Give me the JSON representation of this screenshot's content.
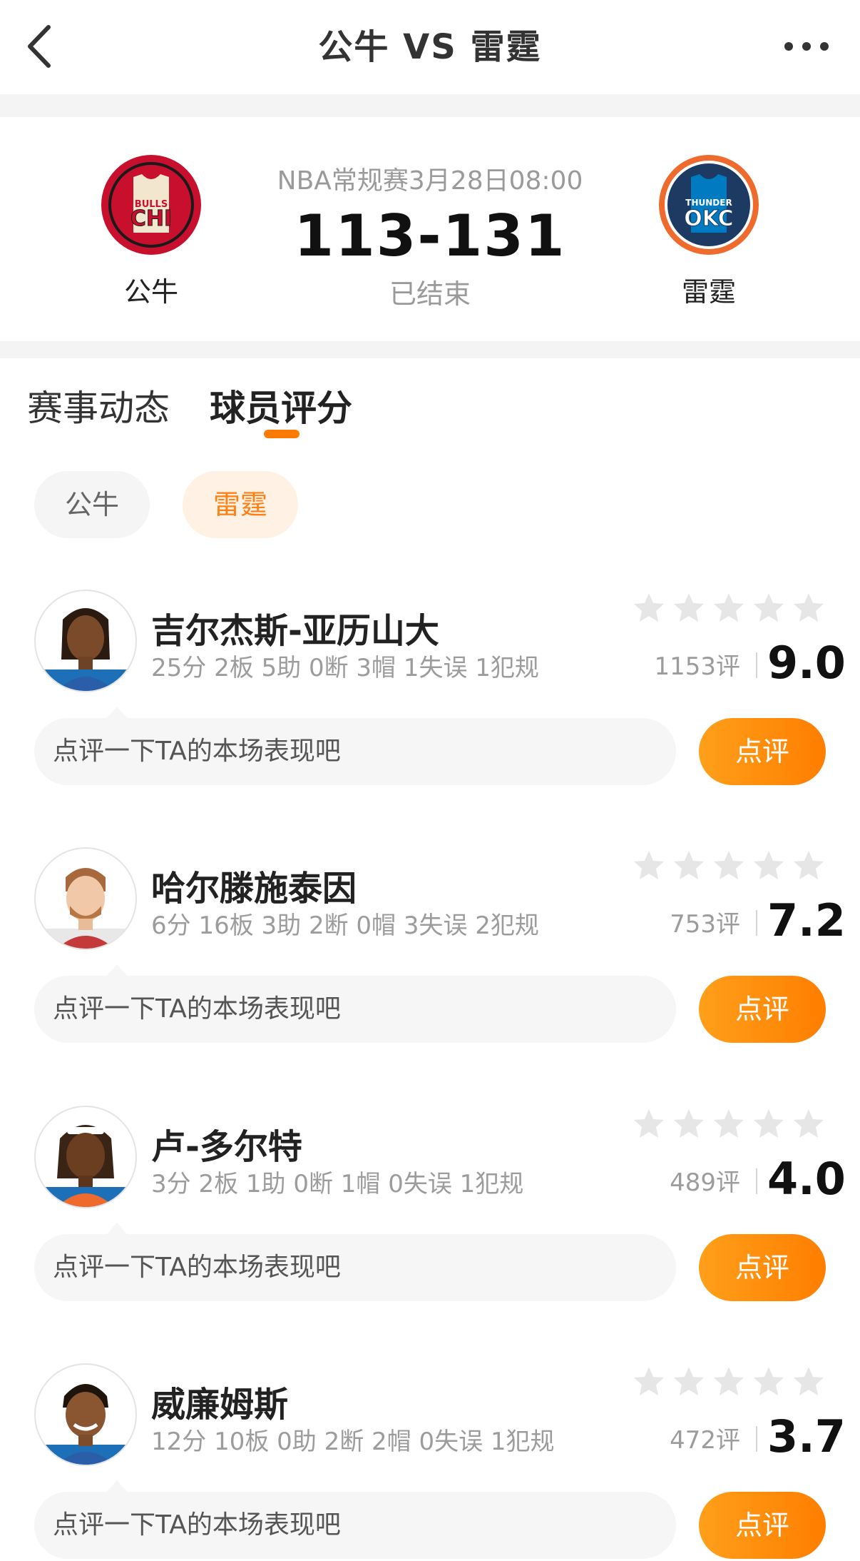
{
  "nav": {
    "title": "公牛 VS 雷霆"
  },
  "match": {
    "info": "NBA常规赛3月28日08:00",
    "score": "113-131",
    "status": "已结束",
    "home": {
      "name": "公牛",
      "logo_text_top": "BULLS",
      "logo_text": "CHI",
      "color": "#c8102e"
    },
    "away": {
      "name": "雷霆",
      "logo_text_top": "THUNDER",
      "logo_text": "OKC",
      "color": "#007ac1",
      "ring": "#ef6a2d"
    }
  },
  "tabs": [
    {
      "label": "赛事动态"
    },
    {
      "label": "球员评分",
      "active": true
    }
  ],
  "team_filter": [
    {
      "label": "公牛"
    },
    {
      "label": "雷霆",
      "active": true
    }
  ],
  "accent_color": "#ff7a00",
  "players": [
    {
      "name": "吉尔杰斯-亚历山大",
      "stats": "25分 2板 5助 0断 3帽 1失误 1犯规",
      "rating_count": "1153评",
      "score": "9.0",
      "comment_placeholder": "点评一下TA的本场表现吧",
      "button": "点评"
    },
    {
      "name": "哈尔滕施泰因",
      "stats": "6分 16板 3助 2断 0帽 3失误 2犯规",
      "rating_count": "753评",
      "score": "7.2",
      "comment_placeholder": "点评一下TA的本场表现吧",
      "button": "点评"
    },
    {
      "name": "卢-多尔特",
      "stats": "3分 2板 1助 0断 1帽 0失误 1犯规",
      "rating_count": "489评",
      "score": "4.0",
      "comment_placeholder": "点评一下TA的本场表现吧",
      "button": "点评"
    },
    {
      "name": "威廉姆斯",
      "stats": "12分 10板 0助 2断 2帽 0失误 1犯规",
      "rating_count": "472评",
      "score": "3.7",
      "comment_placeholder": "点评一下TA的本场表现吧",
      "button": "点评"
    }
  ]
}
